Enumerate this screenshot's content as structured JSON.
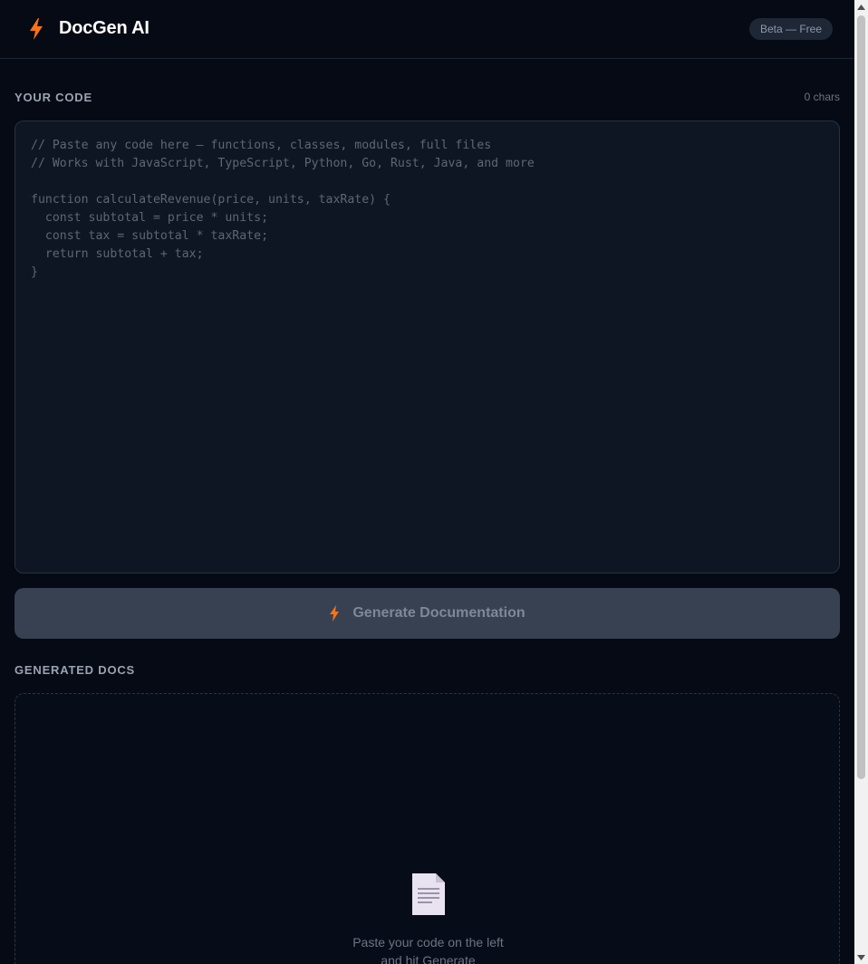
{
  "header": {
    "app_title": "DocGen AI",
    "badge": "Beta — Free",
    "logo_icon": "lightning-bolt-icon"
  },
  "code_section": {
    "label": "YOUR CODE",
    "char_count": "0 chars",
    "placeholder": "// Paste any code here — functions, classes, modules, full files\n// Works with JavaScript, TypeScript, Python, Go, Rust, Java, and more\n\nfunction calculateRevenue(price, units, taxRate) {\n  const subtotal = price * units;\n  const tax = subtotal * taxRate;\n  return subtotal + tax;\n}",
    "value": ""
  },
  "generate_button": {
    "label": "Generate Documentation",
    "icon": "lightning-bolt-icon",
    "enabled": false
  },
  "docs_section": {
    "label": "GENERATED DOCS",
    "empty_icon": "document-icon",
    "empty_line1": "Paste your code on the left",
    "empty_line2": "and hit Generate"
  },
  "colors": {
    "background": "#050a14",
    "accent": "#f97316",
    "editor_bg": "#0e1624",
    "button_bg": "#374152",
    "badge_bg": "#1e2736"
  }
}
